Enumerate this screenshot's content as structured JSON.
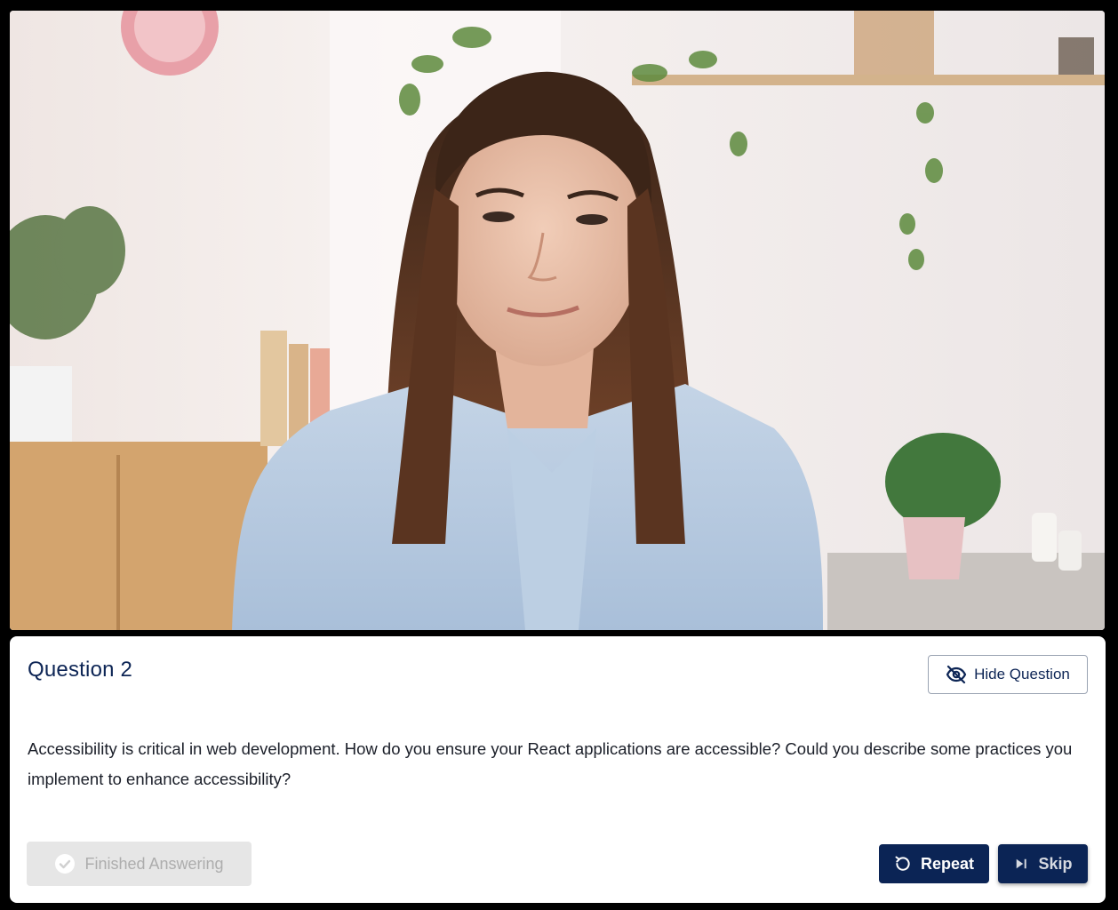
{
  "video": {
    "description_icon": "interviewer-video-feed"
  },
  "question": {
    "title": "Question 2",
    "text": "Accessibility is critical in web development. How do you ensure your React applications are accessible? Could you describe some practices you implement to enhance accessibility?"
  },
  "buttons": {
    "hide_question": "Hide Question",
    "finished_answering": "Finished Answering",
    "repeat": "Repeat",
    "skip": "Skip"
  },
  "icons": {
    "hide": "eye-off-icon",
    "finished": "check-circle-icon",
    "repeat": "rotate-ccw-icon",
    "skip": "skip-forward-icon"
  },
  "colors": {
    "primary": "#0b2455",
    "title": "#0d2555",
    "disabled_bg": "#e6e6e6",
    "disabled_text": "#adadad"
  }
}
